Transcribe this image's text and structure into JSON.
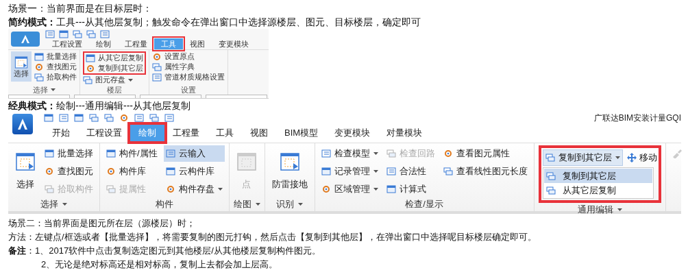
{
  "intro": [
    {
      "text": "场景一：当前界面是在目标层时："
    },
    {
      "text": "**简约模式：**工具---从其他层复制；触发命令在弹出窗口中选择源楼层、图元、目标楼层，确定即可"
    }
  ],
  "simple_ribbon": {
    "tabs": [
      {
        "label": "工程设置",
        "selected": false,
        "highlighted": false
      },
      {
        "label": "绘制",
        "selected": false,
        "highlighted": false
      },
      {
        "label": "工程量",
        "selected": false,
        "highlighted": false
      },
      {
        "label": "工具",
        "selected": true,
        "highlighted": true
      },
      {
        "label": "视图",
        "selected": false,
        "highlighted": false
      },
      {
        "label": "变更模块",
        "selected": false,
        "highlighted": false
      }
    ],
    "groups": [
      {
        "title": "选择",
        "dropdown": true,
        "items": [
          {
            "label": "选择",
            "kind": "large"
          },
          {
            "label": "批量选择",
            "kind": "small"
          },
          {
            "label": "查找图元",
            "kind": "small"
          },
          {
            "label": "拾取构件",
            "kind": "small"
          }
        ]
      },
      {
        "title": "楼层",
        "items": [
          {
            "label": "从其它层复制",
            "kind": "small",
            "highlighted": true
          },
          {
            "label": "复制到其它层",
            "kind": "small",
            "highlighted": true
          },
          {
            "label": "图元存盘",
            "kind": "small",
            "dropdown": true
          }
        ]
      },
      {
        "title": "设置",
        "items": [
          {
            "label": "设置原点",
            "kind": "small"
          },
          {
            "label": "属性字典",
            "kind": "small"
          },
          {
            "label": "管道材质规格设置",
            "kind": "small"
          }
        ]
      }
    ]
  },
  "classic_heading": "**经典模式：**绘制---通用编辑---从其他层复制",
  "classic_ribbon": {
    "app_title": "广联达BIM安装计量GQI",
    "tabs": [
      {
        "label": "开始",
        "selected": false,
        "highlighted": false
      },
      {
        "label": "工程设置",
        "selected": false,
        "highlighted": false
      },
      {
        "label": "绘制",
        "selected": true,
        "highlighted": true
      },
      {
        "label": "工程量",
        "selected": false,
        "highlighted": false
      },
      {
        "label": "工具",
        "selected": false,
        "highlighted": false
      },
      {
        "label": "视图",
        "selected": false,
        "highlighted": false
      },
      {
        "label": "BIM模型",
        "selected": false,
        "highlighted": false
      },
      {
        "label": "变更模块",
        "selected": false,
        "highlighted": false
      },
      {
        "label": "对量模块",
        "selected": false,
        "highlighted": false
      }
    ],
    "groups": [
      {
        "title": "选择",
        "dropdown": true,
        "kind": "buttons",
        "items": [
          {
            "label": "选择",
            "kind": "large",
            "disabled": false
          },
          {
            "label": "批量选择",
            "kind": "small",
            "disabled": false
          },
          {
            "label": "查找图元",
            "kind": "small",
            "disabled": false
          },
          {
            "label": "拾取构件",
            "kind": "small",
            "disabled": true
          }
        ]
      },
      {
        "title": "构件",
        "kind": "buttons",
        "items": [
          {
            "label": "构件/属性",
            "kind": "small",
            "disabled": false
          },
          {
            "label": "构件库",
            "kind": "small",
            "disabled": false
          },
          {
            "label": "提属性",
            "kind": "small",
            "disabled": true
          },
          {
            "label": "云输入",
            "kind": "small",
            "disabled": false,
            "selected": true
          },
          {
            "label": "云构件库",
            "kind": "small",
            "disabled": false
          },
          {
            "label": "构件存盘",
            "kind": "small",
            "disabled": false,
            "dropdown": true
          }
        ]
      },
      {
        "title": "绘图",
        "dropdown": true,
        "kind": "buttons",
        "items": [
          {
            "label": "点",
            "kind": "large",
            "disabled": true
          }
        ]
      },
      {
        "title": "识别",
        "dropdown": true,
        "kind": "buttons",
        "items": [
          {
            "label": "防雷接地",
            "kind": "large",
            "disabled": false
          }
        ]
      },
      {
        "title": "检查/显示",
        "kind": "buttons",
        "items": [
          {
            "label": "检查模型",
            "kind": "small",
            "disabled": false,
            "dropdown": true
          },
          {
            "label": "记录管理",
            "kind": "small",
            "disabled": false,
            "dropdown": true
          },
          {
            "label": "区域管理",
            "kind": "small",
            "disabled": false,
            "dropdown": true
          },
          {
            "label": "检查回路",
            "kind": "small",
            "disabled": true
          },
          {
            "label": "合法性",
            "kind": "small",
            "disabled": false
          },
          {
            "label": "计算式",
            "kind": "small",
            "disabled": false
          },
          {
            "label": "查看图元属性",
            "kind": "small",
            "disabled": false
          },
          {
            "label": "查看线性图元长度",
            "kind": "small",
            "disabled": false
          }
        ]
      },
      {
        "title": "通用编辑",
        "dropdown": true,
        "kind": "menu_open",
        "highlighted": true,
        "split": {
          "label": "复制到其它层"
        },
        "side": {
          "label": "移动"
        },
        "menu": [
          {
            "label": "复制到其它层",
            "selected": true
          },
          {
            "label": "从其它层复制",
            "selected": false
          }
        ]
      }
    ]
  },
  "notes": [
    {
      "text": "场景二：当前界面是图元所在层（源楼层）时；",
      "indent": false
    },
    {
      "text": "方法：左键点/框选或者【批量选择】，将需要复制的图元打钩，然后点击【复制到其他层】，在弹出窗口中选择呢目标楼层确定即可。",
      "indent": false
    },
    {
      "text": "**备注**：1、2017软件中点击复制选定图元到其他楼层/从其他楼层复制构件图元。",
      "indent": false
    },
    {
      "text": "2、无论是绝对标高还是相对标高，复制上去都会加上层高。",
      "indent": true
    }
  ]
}
